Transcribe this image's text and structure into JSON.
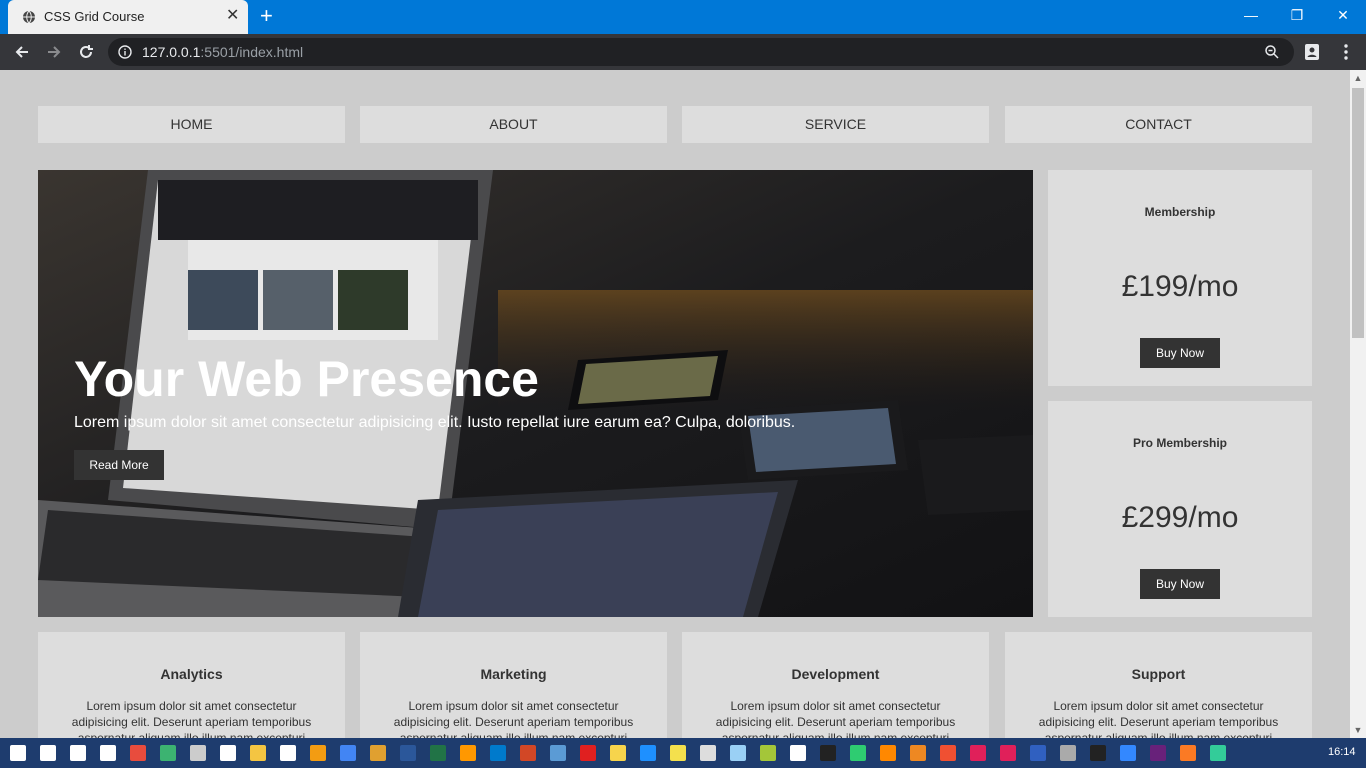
{
  "browser": {
    "tab_title": "CSS Grid Course",
    "tab_close": "✕",
    "new_tab": "+",
    "url_host": "127.0.0.1",
    "url_rest": ":5501/index.html",
    "window_controls": [
      "—",
      "❐",
      "✕"
    ]
  },
  "nav": [
    {
      "label": "HOME"
    },
    {
      "label": "ABOUT"
    },
    {
      "label": "SERVICE"
    },
    {
      "label": "CONTACT"
    }
  ],
  "hero": {
    "title": "Your Web Presence",
    "text": "Lorem ipsum dolor sit amet consectetur adipisicing elit. Iusto repellat iure earum ea? Culpa, doloribus.",
    "button": "Read More"
  },
  "cards": [
    {
      "label": "Membership",
      "price": "£199/mo",
      "button": "Buy Now"
    },
    {
      "label": "Pro Membership",
      "price": "£299/mo",
      "button": "Buy Now"
    }
  ],
  "services": [
    {
      "title": "Analytics",
      "text": "Lorem ipsum dolor sit amet consectetur adipisicing elit. Deserunt aperiam temporibus aspernatur aliquam illo illum nam excepturi"
    },
    {
      "title": "Marketing",
      "text": "Lorem ipsum dolor sit amet consectetur adipisicing elit. Deserunt aperiam temporibus aspernatur aliquam illo illum nam excepturi"
    },
    {
      "title": "Development",
      "text": "Lorem ipsum dolor sit amet consectetur adipisicing elit. Deserunt aperiam temporibus aspernatur aliquam illo illum nam excepturi"
    },
    {
      "title": "Support",
      "text": "Lorem ipsum dolor sit amet consectetur adipisicing elit. Deserunt aperiam temporibus aspernatur aliquam illo illum nam excepturi"
    }
  ],
  "taskbar": {
    "clock": "16:14",
    "icons": [
      "start-icon",
      "cortana-icon",
      "task-view-icon",
      "mail-icon",
      "paint-icon",
      "sync-icon",
      "calculator-icon",
      "settings-icon",
      "file-explorer-icon",
      "notepad-icon",
      "media-player-icon",
      "chrome-icon",
      "chrome-canary-icon",
      "word-icon",
      "excel-icon",
      "sublime-icon",
      "vscode-icon",
      "powerpoint-icon",
      "remote-desktop-icon",
      "acrobat-icon",
      "sticky-notes-icon",
      "network-icon",
      "notes-icon",
      "tool-icon",
      "snowflake-icon",
      "android-icon",
      "intellij-icon",
      "terminal-icon",
      "chat-icon",
      "vlc-icon",
      "matlab-icon",
      "git-icon",
      "red-app-icon",
      "word-mobile-icon",
      "printer-icon",
      "cmd-icon",
      "paint-3d-icon",
      "visual-studio-icon",
      "xampp-icon",
      "git-kraken-icon",
      "chrome-active-icon"
    ]
  }
}
